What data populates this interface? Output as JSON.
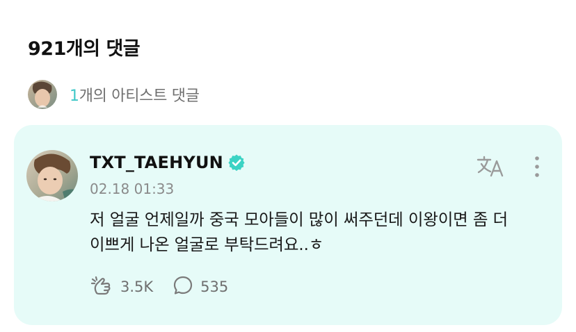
{
  "header": {
    "comment_count_label": "921개의 댓글"
  },
  "artist_comments": {
    "count": "1",
    "label": "개의 아티스트 댓글"
  },
  "comment": {
    "author": "TXT_TAEHYUN",
    "timestamp": "02.18 01:33",
    "text": "저 얼굴 언제일까 중국 모아들이 많이 써주던데 이왕이면 좀 더 이쁘게 나온 얼굴로 부탁드려요..ㅎ",
    "likes": "3.5K",
    "replies": "535"
  },
  "icons": {
    "verified": "verified-badge-icon",
    "translate": "translate-icon",
    "more": "more-vertical-icon",
    "like": "like-icon",
    "reply": "reply-bubble-icon"
  },
  "colors": {
    "card_background": "#e6fbf8",
    "accent": "#3ec7c7",
    "verified_badge": "#3bd3c4",
    "secondary_text": "#8a8a8a"
  }
}
